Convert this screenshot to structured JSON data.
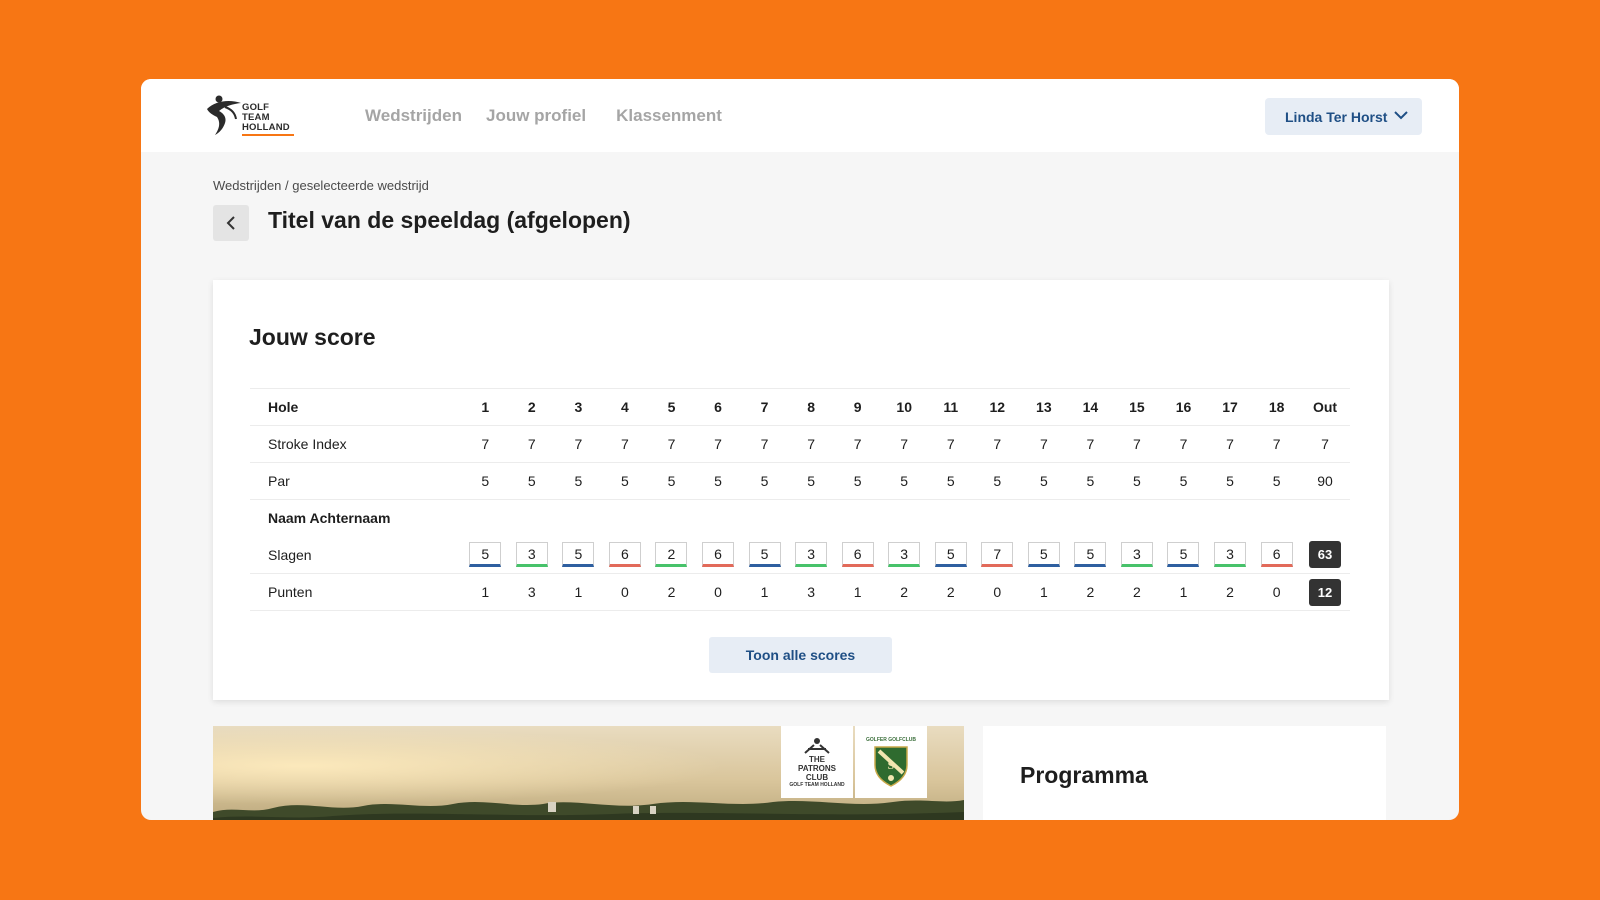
{
  "logo": {
    "lines": [
      "GOLF",
      "TEAM",
      "HOLLAND"
    ]
  },
  "nav": {
    "items": [
      "Wedstrijden",
      "Jouw profiel",
      "Klassenment"
    ]
  },
  "user": {
    "name": "Linda Ter Horst"
  },
  "breadcrumb": "Wedstrijden / geselecteerde wedstrijd",
  "page": {
    "title": "Titel van de speeldag (afgelopen)"
  },
  "score": {
    "title": "Jouw score",
    "header": {
      "label": "Hole",
      "holes": [
        "1",
        "2",
        "3",
        "4",
        "5",
        "6",
        "7",
        "8",
        "9",
        "10",
        "11",
        "12",
        "13",
        "14",
        "15",
        "16",
        "17",
        "18"
      ],
      "out": "Out"
    },
    "stroke_index": {
      "label": "Stroke Index",
      "values": [
        "7",
        "7",
        "7",
        "7",
        "7",
        "7",
        "7",
        "7",
        "7",
        "7",
        "7",
        "7",
        "7",
        "7",
        "7",
        "7",
        "7",
        "7"
      ],
      "out": "7"
    },
    "par": {
      "label": "Par",
      "values": [
        "5",
        "5",
        "5",
        "5",
        "5",
        "5",
        "5",
        "5",
        "5",
        "5",
        "5",
        "5",
        "5",
        "5",
        "5",
        "5",
        "5",
        "5"
      ],
      "out": "90"
    },
    "player": {
      "name": "Naam Achternaam"
    },
    "slagen": {
      "label": "Slagen",
      "values": [
        "5",
        "3",
        "5",
        "6",
        "2",
        "6",
        "5",
        "3",
        "6",
        "3",
        "5",
        "7",
        "5",
        "5",
        "3",
        "5",
        "3",
        "6"
      ],
      "colors": [
        "blue",
        "green",
        "blue",
        "red",
        "green",
        "red",
        "blue",
        "green",
        "red",
        "green",
        "blue",
        "red",
        "blue",
        "blue",
        "green",
        "blue",
        "green",
        "red"
      ],
      "total": "63"
    },
    "punten": {
      "label": "Punten",
      "values": [
        "1",
        "3",
        "1",
        "0",
        "2",
        "0",
        "1",
        "3",
        "1",
        "2",
        "2",
        "0",
        "1",
        "2",
        "2",
        "1",
        "2",
        "0"
      ],
      "total": "12"
    },
    "show_all": "Toon alle scores"
  },
  "sponsors": {
    "one": {
      "lines": [
        "THE",
        "PATRONS",
        "CLUB"
      ],
      "sub": "GOLF TEAM HOLLAND"
    },
    "two": {
      "top": "GOLFER GOLFCLUB"
    }
  },
  "programma": {
    "title": "Programma"
  },
  "colors": {
    "background": "#f77614",
    "accent_blue": "#1f4f85",
    "bar_green": "#47c26a",
    "bar_red": "#e26a5a",
    "bar_blue": "#2e5fa0"
  }
}
